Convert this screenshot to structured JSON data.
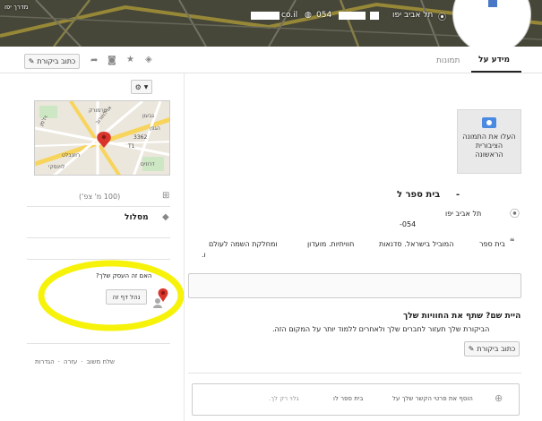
{
  "banner": {
    "place_top": "תל אביב יפו",
    "phone_prefix": "054",
    "domain_suffix": "co.il",
    "corner_label": "מדרך יפו"
  },
  "tabs": [
    {
      "label": "מידע על"
    },
    {
      "label": "תמונות"
    }
  ],
  "toolbar": {
    "write_review_label": "כתוב ביקורת"
  },
  "upload_photo": {
    "label": "העלו את התמונה הציבורית הראשונה"
  },
  "place": {
    "name_end": "בית ספר ל",
    "dash": "-",
    "city": "תל אביב יפו",
    "phone": "054-",
    "description_start": "בית ספר",
    "description_mid": "המוביל בישראל. סדנאות",
    "description_mid2": "חוויתיות. מועדון",
    "description_end": "ומחלקת השמה לעולם",
    "description_line2": "ו."
  },
  "experience": {
    "title": "היית שם? שתף את החוויות שלך",
    "body": "הביקורת שלך תעזור לחברים שלך ולאחרים ללמוד יותר על המקום הזה.",
    "button_label": "כתוב ביקורת"
  },
  "add_contact": {
    "prefix": "הוסף את פרטי הקשר שלך על",
    "school": "בית ספר לו",
    "suffix": "גלוי רק לך."
  },
  "map": {
    "labels": [
      "3362",
      "T1",
      "ויז'מן",
      "מרמורק",
      "גבעון",
      "ארלוזורוב",
      "לוינסקי",
      "הגפן",
      "דרוזים",
      "רוזנבלט"
    ]
  },
  "sidebar": {
    "area_label": "(100 מ' צפ')",
    "route_label": "מסלול",
    "owner_question": "האם זה העסק שלך?",
    "manage_page_label": "נהל דף זה",
    "footer": {
      "settings": "הגדרות",
      "help": "עזרה",
      "feedback": "שלח משוב"
    }
  },
  "colors": {
    "tab_active_border": "#222222",
    "photo_box_bg": "#e9e9e9",
    "camera_blue": "#4a8ae0",
    "highlight_yellow": "#f6f20a",
    "pin_red": "#d9342b"
  }
}
